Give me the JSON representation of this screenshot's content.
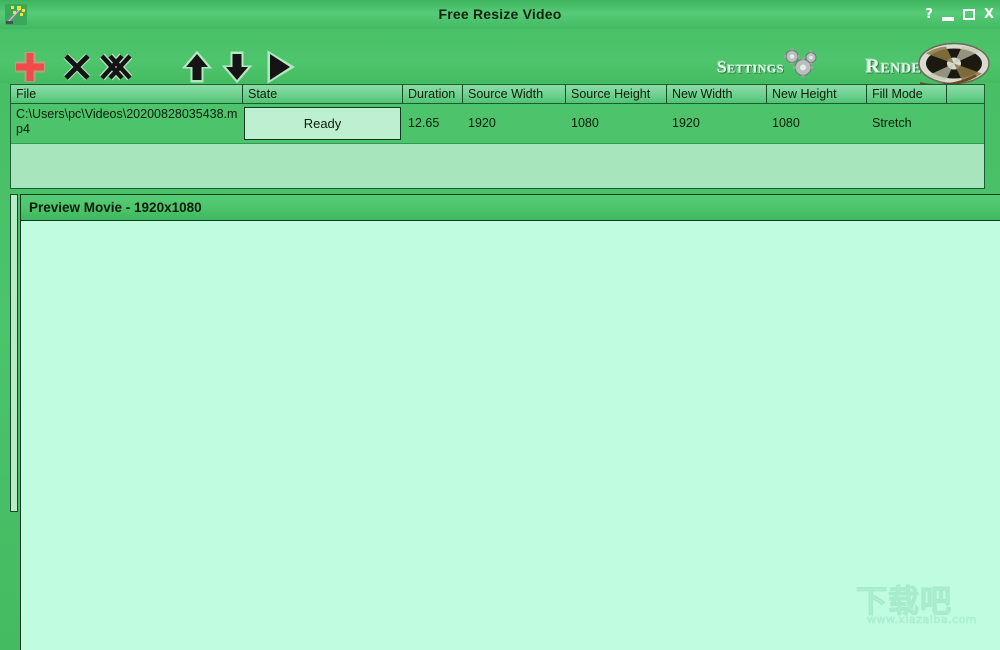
{
  "window": {
    "title": "Free Resize Video",
    "app_icon": "magic-wand-icon",
    "help_label": "?",
    "minimize_label": "",
    "maximize_label": "",
    "close_label": "X"
  },
  "toolbar": {
    "add_label": "+",
    "add_icon": "plus-icon",
    "remove_icon": "x-icon",
    "remove_all_icon": "double-x-icon",
    "move_up_icon": "arrow-up-icon",
    "move_down_icon": "arrow-down-icon",
    "play_icon": "play-icon",
    "settings_label": "Settings",
    "settings_icon": "gear-icon",
    "render_label": "Render",
    "render_icon": "film-reel-icon"
  },
  "file_list": {
    "columns": [
      "File",
      "State",
      "Duration",
      "Source Width",
      "Source Height",
      "New Width",
      "New Height",
      "Fill Mode",
      ""
    ],
    "rows": [
      {
        "file": "C:\\Users\\pc\\Videos\\20200828035438.mp4",
        "state": "Ready",
        "duration": "12.65",
        "source_width": "1920",
        "source_height": "1080",
        "new_width": "1920",
        "new_height": "1080",
        "fill_mode": "Stretch",
        "tail": ""
      }
    ]
  },
  "preview": {
    "title": "Preview Movie - 1920x1080"
  },
  "watermark": {
    "text": "下载吧",
    "url": "www.xiazaiba.com"
  },
  "colors": {
    "window_green": "#4dc46b",
    "header_green": "#6ed18e",
    "panel_mint": "#bffce0",
    "row_green": "#4dc46b",
    "border_dark": "#0f3a21",
    "accent_red": "#f05a5a"
  }
}
